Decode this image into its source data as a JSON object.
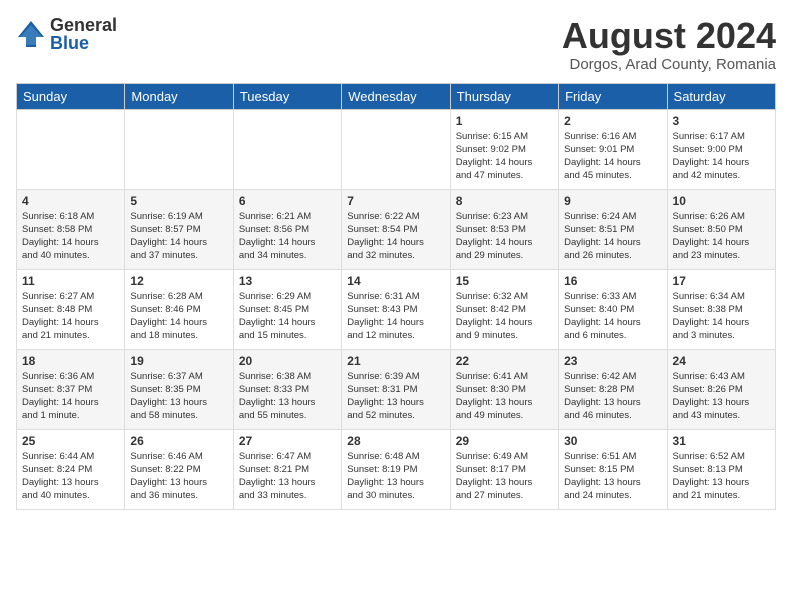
{
  "logo": {
    "general": "General",
    "blue": "Blue"
  },
  "header": {
    "month_year": "August 2024",
    "location": "Dorgos, Arad County, Romania"
  },
  "weekdays": [
    "Sunday",
    "Monday",
    "Tuesday",
    "Wednesday",
    "Thursday",
    "Friday",
    "Saturday"
  ],
  "weeks": [
    [
      {
        "day": "",
        "info": ""
      },
      {
        "day": "",
        "info": ""
      },
      {
        "day": "",
        "info": ""
      },
      {
        "day": "",
        "info": ""
      },
      {
        "day": "1",
        "info": "Sunrise: 6:15 AM\nSunset: 9:02 PM\nDaylight: 14 hours\nand 47 minutes."
      },
      {
        "day": "2",
        "info": "Sunrise: 6:16 AM\nSunset: 9:01 PM\nDaylight: 14 hours\nand 45 minutes."
      },
      {
        "day": "3",
        "info": "Sunrise: 6:17 AM\nSunset: 9:00 PM\nDaylight: 14 hours\nand 42 minutes."
      }
    ],
    [
      {
        "day": "4",
        "info": "Sunrise: 6:18 AM\nSunset: 8:58 PM\nDaylight: 14 hours\nand 40 minutes."
      },
      {
        "day": "5",
        "info": "Sunrise: 6:19 AM\nSunset: 8:57 PM\nDaylight: 14 hours\nand 37 minutes."
      },
      {
        "day": "6",
        "info": "Sunrise: 6:21 AM\nSunset: 8:56 PM\nDaylight: 14 hours\nand 34 minutes."
      },
      {
        "day": "7",
        "info": "Sunrise: 6:22 AM\nSunset: 8:54 PM\nDaylight: 14 hours\nand 32 minutes."
      },
      {
        "day": "8",
        "info": "Sunrise: 6:23 AM\nSunset: 8:53 PM\nDaylight: 14 hours\nand 29 minutes."
      },
      {
        "day": "9",
        "info": "Sunrise: 6:24 AM\nSunset: 8:51 PM\nDaylight: 14 hours\nand 26 minutes."
      },
      {
        "day": "10",
        "info": "Sunrise: 6:26 AM\nSunset: 8:50 PM\nDaylight: 14 hours\nand 23 minutes."
      }
    ],
    [
      {
        "day": "11",
        "info": "Sunrise: 6:27 AM\nSunset: 8:48 PM\nDaylight: 14 hours\nand 21 minutes."
      },
      {
        "day": "12",
        "info": "Sunrise: 6:28 AM\nSunset: 8:46 PM\nDaylight: 14 hours\nand 18 minutes."
      },
      {
        "day": "13",
        "info": "Sunrise: 6:29 AM\nSunset: 8:45 PM\nDaylight: 14 hours\nand 15 minutes."
      },
      {
        "day": "14",
        "info": "Sunrise: 6:31 AM\nSunset: 8:43 PM\nDaylight: 14 hours\nand 12 minutes."
      },
      {
        "day": "15",
        "info": "Sunrise: 6:32 AM\nSunset: 8:42 PM\nDaylight: 14 hours\nand 9 minutes."
      },
      {
        "day": "16",
        "info": "Sunrise: 6:33 AM\nSunset: 8:40 PM\nDaylight: 14 hours\nand 6 minutes."
      },
      {
        "day": "17",
        "info": "Sunrise: 6:34 AM\nSunset: 8:38 PM\nDaylight: 14 hours\nand 3 minutes."
      }
    ],
    [
      {
        "day": "18",
        "info": "Sunrise: 6:36 AM\nSunset: 8:37 PM\nDaylight: 14 hours\nand 1 minute."
      },
      {
        "day": "19",
        "info": "Sunrise: 6:37 AM\nSunset: 8:35 PM\nDaylight: 13 hours\nand 58 minutes."
      },
      {
        "day": "20",
        "info": "Sunrise: 6:38 AM\nSunset: 8:33 PM\nDaylight: 13 hours\nand 55 minutes."
      },
      {
        "day": "21",
        "info": "Sunrise: 6:39 AM\nSunset: 8:31 PM\nDaylight: 13 hours\nand 52 minutes."
      },
      {
        "day": "22",
        "info": "Sunrise: 6:41 AM\nSunset: 8:30 PM\nDaylight: 13 hours\nand 49 minutes."
      },
      {
        "day": "23",
        "info": "Sunrise: 6:42 AM\nSunset: 8:28 PM\nDaylight: 13 hours\nand 46 minutes."
      },
      {
        "day": "24",
        "info": "Sunrise: 6:43 AM\nSunset: 8:26 PM\nDaylight: 13 hours\nand 43 minutes."
      }
    ],
    [
      {
        "day": "25",
        "info": "Sunrise: 6:44 AM\nSunset: 8:24 PM\nDaylight: 13 hours\nand 40 minutes."
      },
      {
        "day": "26",
        "info": "Sunrise: 6:46 AM\nSunset: 8:22 PM\nDaylight: 13 hours\nand 36 minutes."
      },
      {
        "day": "27",
        "info": "Sunrise: 6:47 AM\nSunset: 8:21 PM\nDaylight: 13 hours\nand 33 minutes."
      },
      {
        "day": "28",
        "info": "Sunrise: 6:48 AM\nSunset: 8:19 PM\nDaylight: 13 hours\nand 30 minutes."
      },
      {
        "day": "29",
        "info": "Sunrise: 6:49 AM\nSunset: 8:17 PM\nDaylight: 13 hours\nand 27 minutes."
      },
      {
        "day": "30",
        "info": "Sunrise: 6:51 AM\nSunset: 8:15 PM\nDaylight: 13 hours\nand 24 minutes."
      },
      {
        "day": "31",
        "info": "Sunrise: 6:52 AM\nSunset: 8:13 PM\nDaylight: 13 hours\nand 21 minutes."
      }
    ]
  ]
}
